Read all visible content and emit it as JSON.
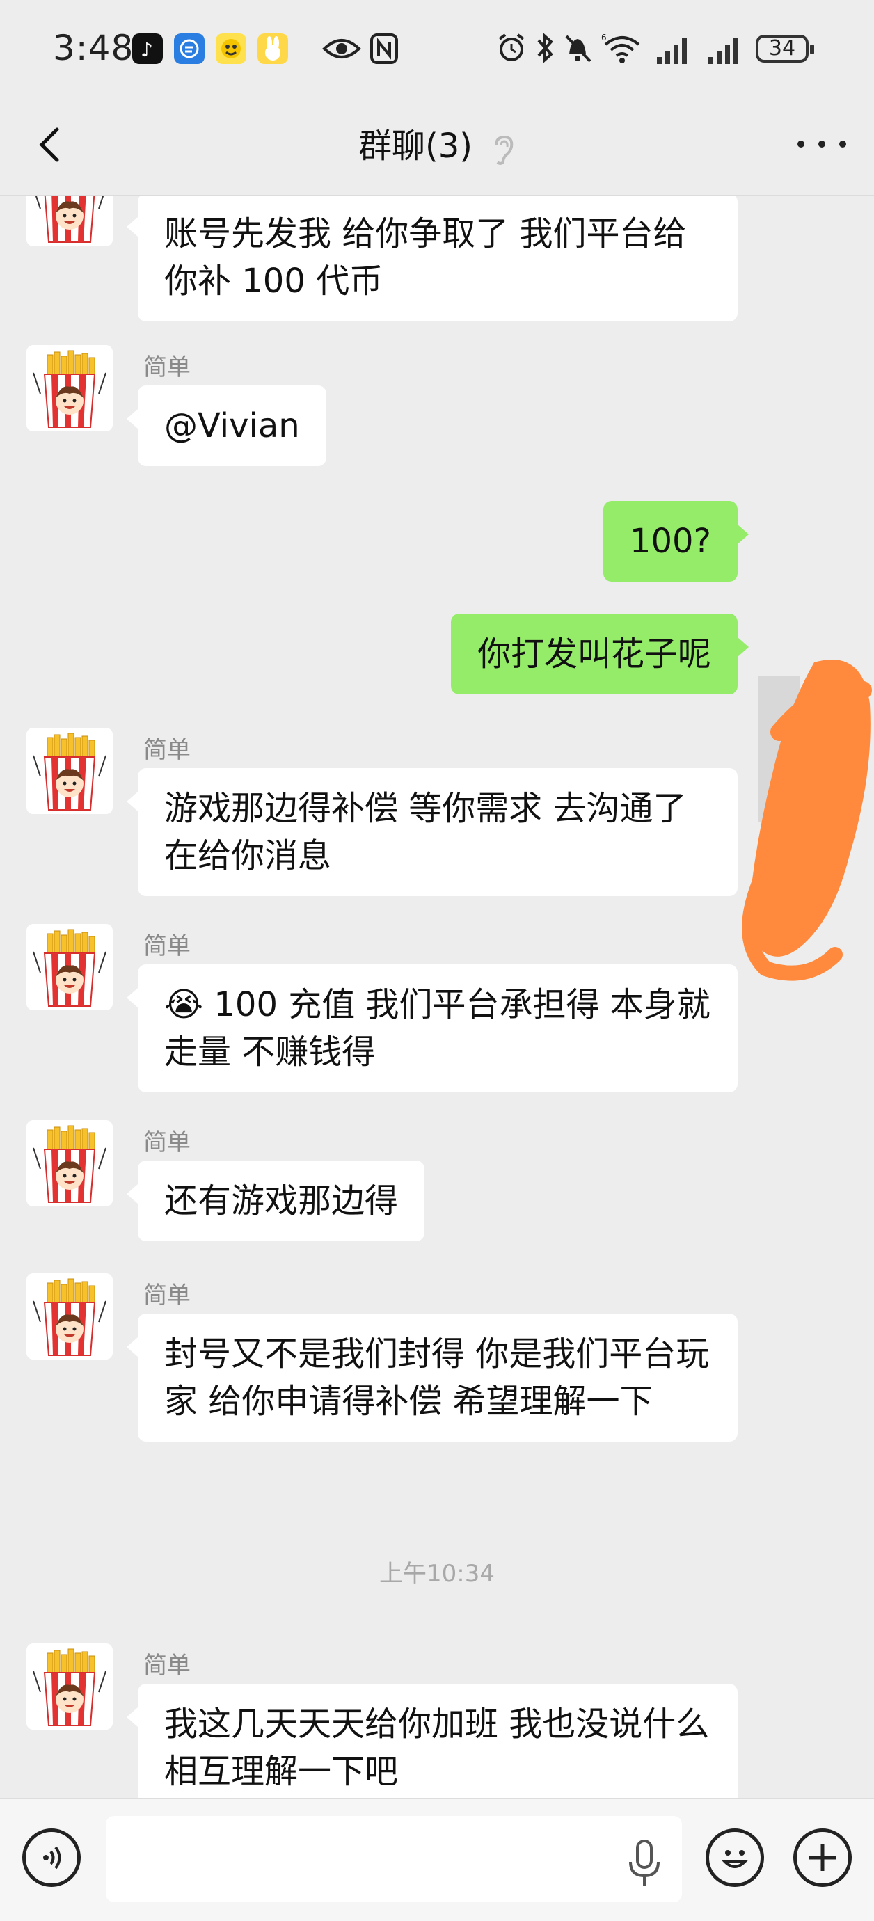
{
  "status_bar": {
    "time": "3:48",
    "battery": "34",
    "icons": [
      "tiktok-icon",
      "app-icon",
      "emoji-app-icon",
      "rabbit-app-icon",
      "eye-icon",
      "nfc-icon",
      "alarm-icon",
      "bluetooth-icon",
      "mute-icon",
      "wifi-icon",
      "signal-icon",
      "signal-icon"
    ]
  },
  "header": {
    "title": "群聊(3)"
  },
  "messages": [
    {
      "direction": "in",
      "sender": "",
      "text": "账号先发我  给你争取了 我们平台给你补 100 代币"
    },
    {
      "direction": "in",
      "sender": "简单",
      "text": "@Vivian"
    },
    {
      "direction": "out",
      "text": "100?"
    },
    {
      "direction": "out",
      "text": "你打发叫花子呢"
    },
    {
      "direction": "in",
      "sender": "简单",
      "text": "游戏那边得补偿 等你需求 去沟通了 在给你消息"
    },
    {
      "direction": "in",
      "sender": "简单",
      "emoji": "😭",
      "text": "100 充值 我们平台承担得  本身就走量 不赚钱得"
    },
    {
      "direction": "in",
      "sender": "简单",
      "text": "还有游戏那边得"
    },
    {
      "direction": "in",
      "sender": "简单",
      "text": "封号又不是我们封得  你是我们平台玩家 给你申请得补偿 希望理解一下"
    },
    {
      "direction": "timestamp",
      "text": "上午10:34"
    },
    {
      "direction": "in",
      "sender": "简单",
      "text": "我这几天天天给你加班 我也没说什么 相互理解一下吧"
    }
  ],
  "colors": {
    "background": "#ededed",
    "incoming_bubble": "#ffffff",
    "outgoing_bubble": "#95ec69",
    "scribble": "#ff8a3d"
  },
  "input_bar": {
    "placeholder": ""
  }
}
